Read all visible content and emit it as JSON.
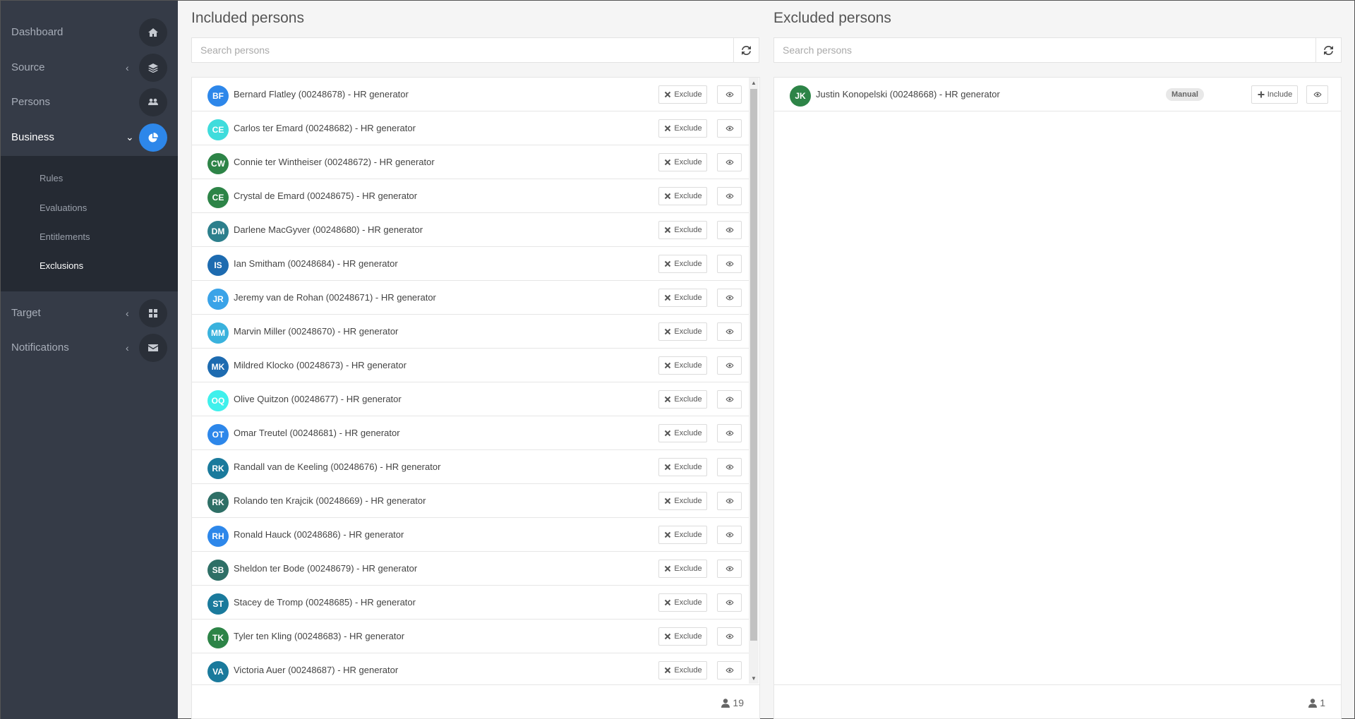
{
  "sidebar": {
    "items": [
      {
        "label": "Dashboard",
        "icon": "home-icon",
        "chevron": "",
        "active": false
      },
      {
        "label": "Source",
        "icon": "layers-icon",
        "chevron": "‹",
        "active": false
      },
      {
        "label": "Persons",
        "icon": "users-icon",
        "chevron": "",
        "active": false
      },
      {
        "label": "Business",
        "icon": "pie-chart-icon",
        "chevron": "⌄",
        "active": true
      },
      {
        "label": "Target",
        "icon": "grid-icon",
        "chevron": "‹",
        "active": false
      },
      {
        "label": "Notifications",
        "icon": "envelope-icon",
        "chevron": "‹",
        "active": false
      }
    ],
    "submenu": [
      "Rules",
      "Evaluations",
      "Entitlements",
      "Exclusions"
    ],
    "submenu_active": "Exclusions"
  },
  "included": {
    "title": "Included persons",
    "search_placeholder": "Search persons",
    "exclude_label": "Exclude",
    "count": "19",
    "persons": [
      {
        "initials": "BF",
        "name": "Bernard Flatley (00248678) - HR generator",
        "color": "#2d87ea"
      },
      {
        "initials": "CE",
        "name": "Carlos ter Emard (00248682) - HR generator",
        "color": "#3fdcdc"
      },
      {
        "initials": "CW",
        "name": "Connie ter Wintheiser (00248672) - HR generator",
        "color": "#2d8447"
      },
      {
        "initials": "CE",
        "name": "Crystal de Emard (00248675) - HR generator",
        "color": "#2d8447"
      },
      {
        "initials": "DM",
        "name": "Darlene MacGyver (00248680) - HR generator",
        "color": "#2c7f8c"
      },
      {
        "initials": "IS",
        "name": "Ian Smitham (00248684) - HR generator",
        "color": "#1d6bb0"
      },
      {
        "initials": "JR",
        "name": "Jeremy van de Rohan (00248671) - HR generator",
        "color": "#3aa3e8"
      },
      {
        "initials": "MM",
        "name": "Marvin Miller (00248670) - HR generator",
        "color": "#3ab2dd"
      },
      {
        "initials": "MK",
        "name": "Mildred Klocko (00248673) - HR generator",
        "color": "#1d6bb0"
      },
      {
        "initials": "OQ",
        "name": "Olive Quitzon (00248677) - HR generator",
        "color": "#3ff0ec"
      },
      {
        "initials": "OT",
        "name": "Omar Treutel (00248681) - HR generator",
        "color": "#2d87ea"
      },
      {
        "initials": "RK",
        "name": "Randall van de Keeling (00248676) - HR generator",
        "color": "#1a7a9c"
      },
      {
        "initials": "RK",
        "name": "Rolando ten Krajcik (00248669) - HR generator",
        "color": "#2e6f66"
      },
      {
        "initials": "RH",
        "name": "Ronald Hauck (00248686) - HR generator",
        "color": "#2d87ea"
      },
      {
        "initials": "SB",
        "name": "Sheldon ter Bode (00248679) - HR generator",
        "color": "#2e6f66"
      },
      {
        "initials": "ST",
        "name": "Stacey de Tromp (00248685) - HR generator",
        "color": "#1a7a9c"
      },
      {
        "initials": "TK",
        "name": "Tyler ten Kling (00248683) - HR generator",
        "color": "#2d8447"
      },
      {
        "initials": "VA",
        "name": "Victoria Auer (00248687) - HR generator",
        "color": "#1a7a9c"
      }
    ]
  },
  "excluded": {
    "title": "Excluded persons",
    "search_placeholder": "Search persons",
    "include_label": "Include",
    "count": "1",
    "persons": [
      {
        "initials": "JK",
        "name": "Justin Konopelski (00248668) - HR generator",
        "color": "#2d8447",
        "badge": "Manual"
      }
    ]
  }
}
